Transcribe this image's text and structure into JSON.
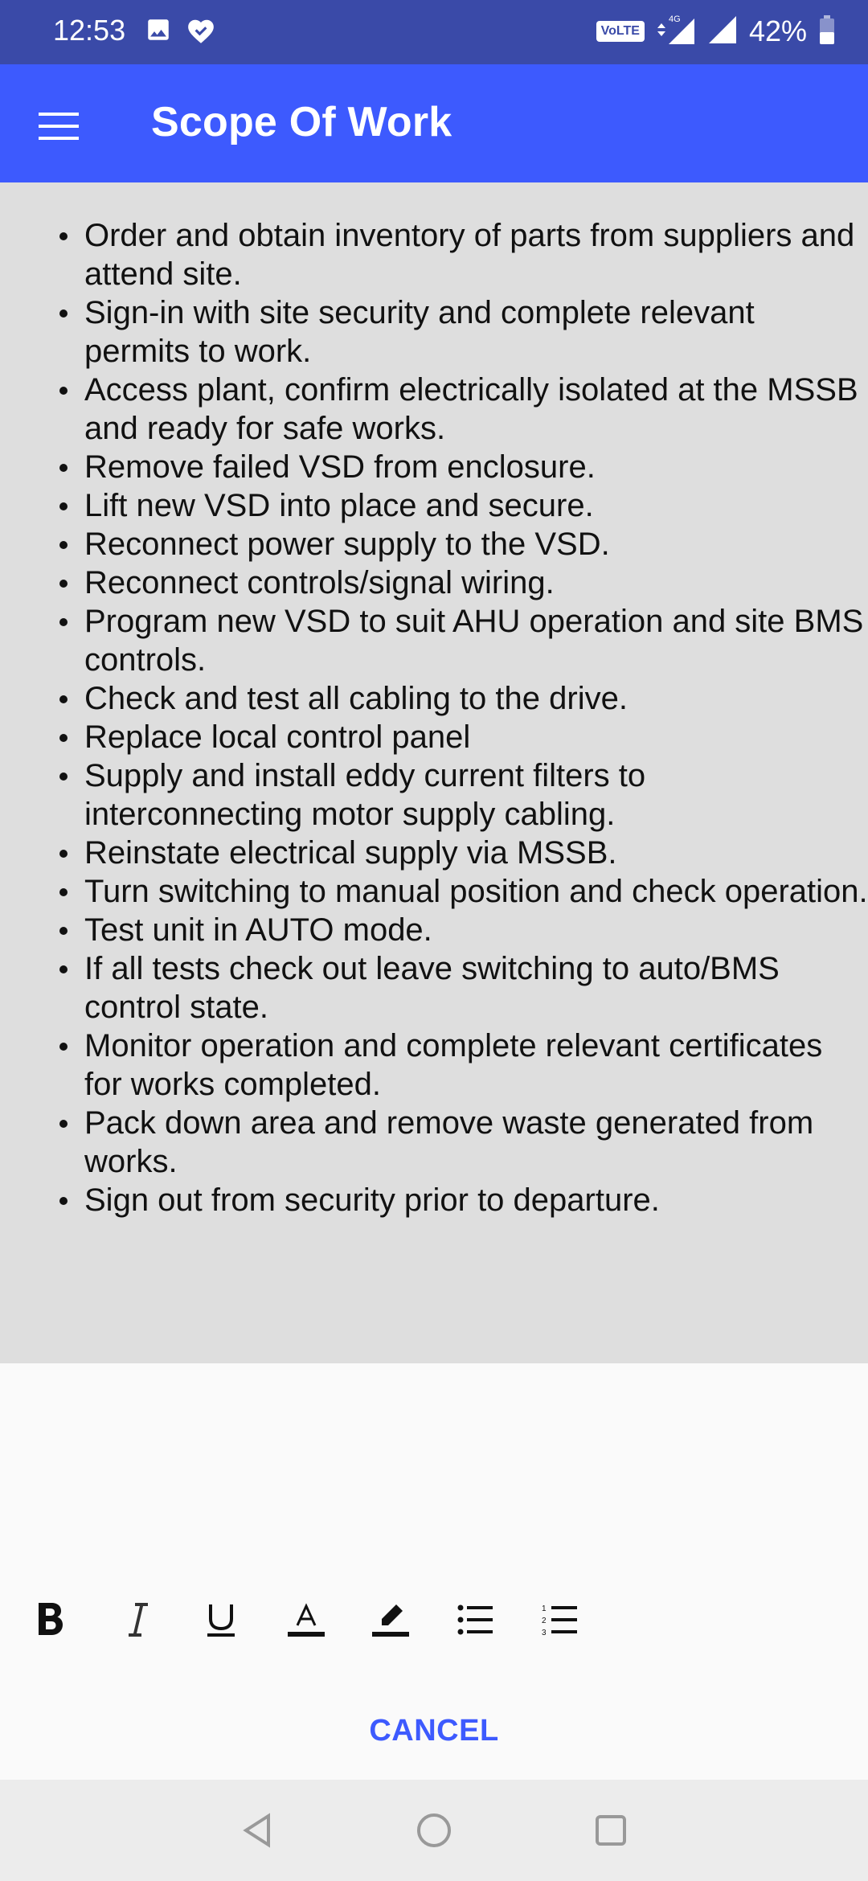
{
  "status_bar": {
    "time": "12:53",
    "volte": "VoLTE",
    "network": "4G",
    "battery": "42%",
    "icons": [
      "image-icon",
      "heart-icon",
      "signal-icon",
      "battery-icon"
    ]
  },
  "app_bar": {
    "title": "Scope Of Work",
    "menu_icon": "hamburger-menu-icon"
  },
  "scope_items": [
    "Order and obtain inventory of parts from suppliers and attend site.",
    "Sign-in with site security and complete relevant permits to work.",
    "Access plant, confirm electrically isolated at the MSSB and ready for safe works.",
    "Remove failed VSD from enclosure.",
    "Lift new VSD into place and secure.",
    "Reconnect power supply to the VSD.",
    "Reconnect controls/signal wiring.",
    "Program new VSD to suit AHU operation and site BMS controls.",
    "Check and test all cabling to the drive.",
    "Replace local control panel",
    "Supply and install eddy current filters to interconnecting motor supply cabling.",
    "Reinstate electrical supply via MSSB.",
    "Turn switching to manual position and check operation.",
    "Test unit in AUTO mode.",
    "If all tests check out leave switching to auto/BMS control state.",
    "Monitor operation and complete relevant certificates for works completed.",
    "Pack down area and remove waste generated from works.",
    "Sign out from security prior to departure."
  ],
  "toolbar": {
    "tools": [
      "bold-icon",
      "italic-icon",
      "underline-icon",
      "text-color-icon",
      "highlight-icon",
      "bullet-list-icon",
      "numbered-list-icon"
    ],
    "cancel_label": "CANCEL"
  },
  "colors": {
    "status_bar": "#3a4aa8",
    "app_bar": "#3d5afe",
    "content_bg": "#dedede",
    "accent": "#3d5afe"
  }
}
